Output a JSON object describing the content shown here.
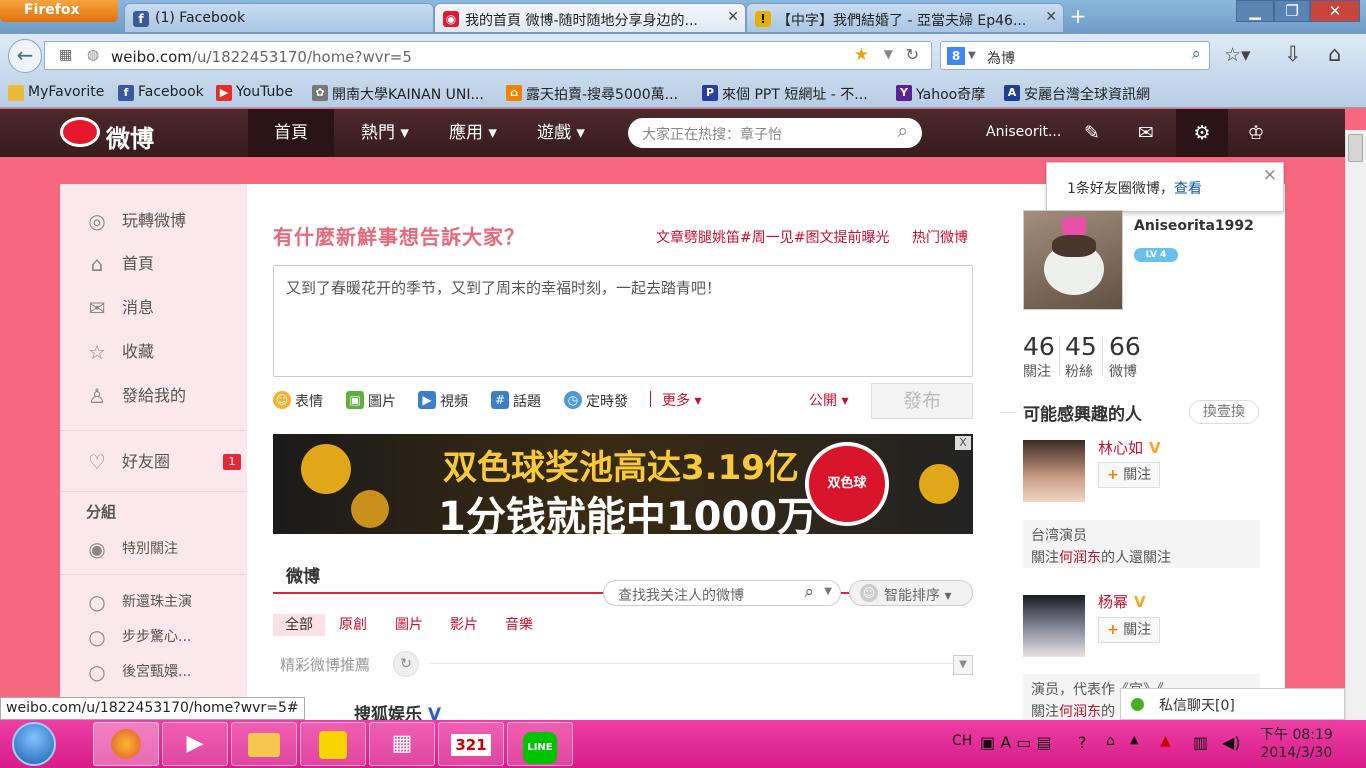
{
  "browser": {
    "menu_button": "Firefox",
    "tabs": [
      {
        "title": "(1) Facebook",
        "icon": "facebook-icon",
        "active": false
      },
      {
        "title": "我的首頁 微博-随时随地分享身边的...",
        "icon": "weibo-icon",
        "active": true
      },
      {
        "title": "【中字】我們結婚了 - 亞當夫婦 Ep46...",
        "icon": "warning-icon",
        "active": false
      }
    ],
    "new_tab": "+",
    "window_buttons": [
      "▁",
      "❐",
      "✕"
    ],
    "url": {
      "host": "weibo.com",
      "path": "/u/1822453170/home?wvr=5"
    },
    "search_value": "為博",
    "bookmarks": [
      "MyFavorite",
      "Facebook",
      "YouTube",
      "開南大學KAINAN UNI...",
      "露天拍賣-搜尋5000萬...",
      "來個 PPT 短網址 - 不...",
      "Yahoo奇摩",
      "安麗台灣全球資訊網"
    ],
    "status_url": "weibo.com/u/1822453170/home?wvr=5#"
  },
  "weibo": {
    "logo_text": "微博",
    "nav": [
      {
        "label": "首頁",
        "current": true
      },
      {
        "label": "熱門 ▾",
        "current": false
      },
      {
        "label": "應用 ▾",
        "current": false
      },
      {
        "label": "遊戲 ▾",
        "current": false
      }
    ],
    "search_placeholder": "大家正在热搜：章子怡",
    "username": "Aniseorit...",
    "left_nav": [
      "玩轉微博",
      "首頁",
      "消息",
      "收藏",
      "發給我的"
    ],
    "friend_circle": {
      "label": "好友圈",
      "badge": "1"
    },
    "group_title": "分組",
    "groups": [
      "特別關注",
      "新還珠主演",
      "步步驚心...",
      "後宮甄嬛..."
    ],
    "notif": {
      "text": "1条好友圈微博，",
      "link": "查看"
    },
    "composer": {
      "prompt": "有什麼新鮮事想告訴大家？",
      "hot_topics": "文章劈腿姚笛#周一见#图文提前曝光",
      "hot_weibo": "热门微博",
      "text": "又到了春暖花开的季节，又到了周末的幸福时刻，一起去踏青吧！",
      "tools": [
        "表情",
        "圖片",
        "視頻",
        "話題",
        "定時發"
      ],
      "more": "更多 ▾",
      "visibility": "公開 ▾",
      "post": "發布"
    },
    "ad": {
      "line1": "双色球奖池高达3.19亿",
      "line2": "1分钱就能中1000万",
      "badge": "双色球",
      "close": "X"
    },
    "feed": {
      "tab": "微博",
      "search_placeholder": "查找我关注人的微博",
      "sort": "智能排序 ▾",
      "filters": [
        "全部",
        "原創",
        "圖片",
        "影片",
        "音樂"
      ],
      "recommend": "精彩微博推薦",
      "first_author": "搜狐娱乐",
      "verified": "V"
    },
    "profile": {
      "name": "Aniseorita1992",
      "level": "LV 4",
      "stats": [
        {
          "num": "46",
          "label": "關注"
        },
        {
          "num": "45",
          "label": "粉絲"
        },
        {
          "num": "66",
          "label": "微博"
        }
      ]
    },
    "interest": {
      "title": "可能感興趣的人",
      "swap": "換壹換",
      "people": [
        {
          "name": "林心如",
          "follow": "關注",
          "info1": "台湾演员",
          "info2_pre": "關注",
          "info2_link": "何润东",
          "info2_post": "的人還關注"
        },
        {
          "name": "杨幂",
          "follow": "關注",
          "info1": "演员，代表作《宫》《",
          "info2_pre": "關注",
          "info2_link": "何润东",
          "info2_post": "的"
        }
      ]
    },
    "pm_chat": "私信聊天[0]"
  },
  "taskbar": {
    "lang": "CH",
    "time": "下午 08:19",
    "date": "2014/3/30",
    "apps": [
      "firefox",
      "media",
      "explorer",
      "app",
      "calculator",
      "calendar",
      "line"
    ],
    "calendar_num": "321",
    "line_label": "LINE"
  }
}
